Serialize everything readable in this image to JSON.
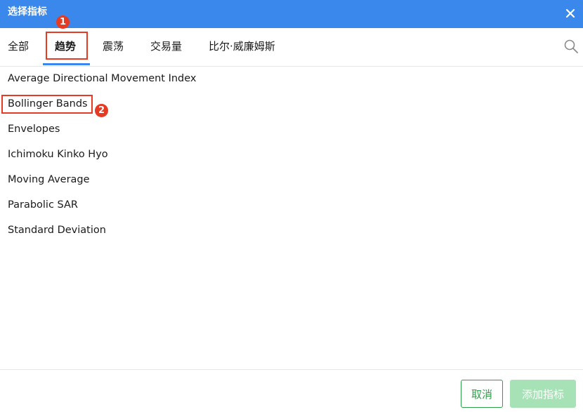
{
  "dialog": {
    "title": "选择指标"
  },
  "tabs": [
    {
      "label": "全部"
    },
    {
      "label": "趋势",
      "active": true
    },
    {
      "label": "震荡"
    },
    {
      "label": "交易量"
    },
    {
      "label": "比尔·威廉姆斯"
    }
  ],
  "indicators": [
    {
      "label": "Average Directional Movement Index"
    },
    {
      "label": "Bollinger Bands"
    },
    {
      "label": "Envelopes"
    },
    {
      "label": "Ichimoku Kinko Hyo"
    },
    {
      "label": "Moving Average"
    },
    {
      "label": "Parabolic SAR"
    },
    {
      "label": "Standard Deviation"
    }
  ],
  "footer": {
    "cancel_label": "取消",
    "add_label": "添加指标"
  },
  "annotations": [
    {
      "number": "1"
    },
    {
      "number": "2"
    }
  ],
  "colors": {
    "titlebar": "#3b88ec",
    "tab_underline": "#3b88ec",
    "annotation": "#e53b24",
    "cancel_border": "#2ea04a",
    "add_bg_disabled": "#a7e1b6"
  },
  "icons": {
    "close": "close-icon",
    "search": "search-icon"
  }
}
